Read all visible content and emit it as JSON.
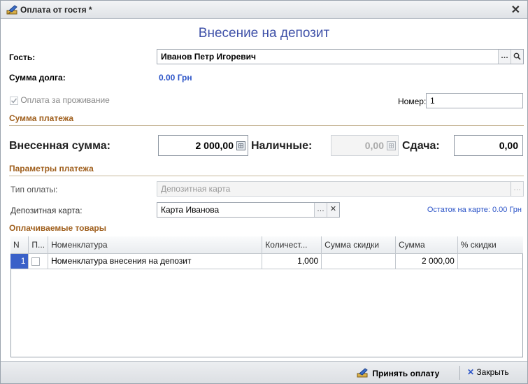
{
  "window": {
    "title": "Оплата от гостя *"
  },
  "form": {
    "heading": "Внесение на депозит",
    "guest_label": "Гость:",
    "guest_value": "Иванов Петр Игоревич",
    "debt_label": "Сумма долга:",
    "debt_value": "0.00 Грн",
    "accommodation_label": "Оплата за проживание",
    "number_label": "Номер:",
    "number_value": "1"
  },
  "payment_sum": {
    "section_title": "Сумма платежа",
    "deposited_label": "Внесенная сумма:",
    "deposited_value": "2 000,00",
    "cash_label": "Наличные:",
    "cash_value": "0,00",
    "change_label": "Сдача:",
    "change_value": "0,00"
  },
  "payment_params": {
    "section_title": "Параметры платежа",
    "type_label": "Тип оплаты:",
    "type_value": "Депозитная карта",
    "card_label": "Депозитная карта:",
    "card_value": "Карта Иванова",
    "card_balance": "Остаток на карте: 0.00 Грн"
  },
  "goods": {
    "section_title": "Оплачиваемые товары",
    "columns": [
      "N",
      "П...",
      "Номенклатура",
      "Количест...",
      "Сумма скидки",
      "Сумма",
      "% скидки"
    ],
    "rows": [
      {
        "n": "1",
        "item": "Номенклатура внесения на депозит",
        "qty": "1,000",
        "discount_sum": "",
        "sum": "2 000,00",
        "discount_pct": ""
      }
    ]
  },
  "footer": {
    "accept_label": "Принять оплату",
    "close_label": "Закрыть"
  },
  "colors": {
    "heading": "#3e50a8",
    "section": "#a0601e",
    "link": "#2d55c8",
    "selection": "#3960c8"
  }
}
